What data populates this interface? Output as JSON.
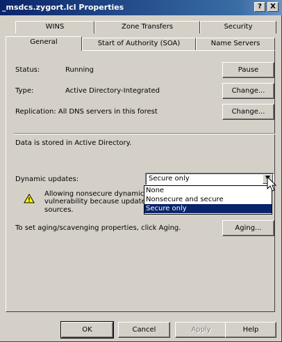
{
  "window": {
    "title": "_msdcs.zygort.lcl Properties",
    "help_label": "?",
    "close_label": "X"
  },
  "tabs_row1": [
    "WINS",
    "Zone Transfers",
    "Security"
  ],
  "tabs_row2": [
    "General",
    "Start of Authority (SOA)",
    "Name Servers"
  ],
  "active_tab": "General",
  "general": {
    "status_label": "Status:",
    "status_value": "Running",
    "pause_label": "Pause",
    "type_label": "Type:",
    "type_value": "Active Directory-Integrated",
    "change_type_label": "Change...",
    "replication_text": "Replication: All DNS servers in this forest",
    "change_replication_label": "Change...",
    "stored_text": "Data is stored in Active Directory.",
    "dynamic_updates_label": "Dynamic updates:",
    "dynamic_updates_value": "Secure only",
    "dynamic_options": [
      "None",
      "Nonsecure and secure",
      "Secure only"
    ],
    "warning_line1": "Allowing nonsecure dynamic u",
    "warning_line2": "vulnerability because updates",
    "warning_line3": "sources.",
    "aging_text": "To set aging/scavenging properties, click Aging.",
    "aging_button": "Aging..."
  },
  "footer": {
    "ok": "OK",
    "cancel": "Cancel",
    "apply": "Apply",
    "help": "Help"
  },
  "icons": {
    "warning": "warning-triangle-icon",
    "dropdown_arrow": "chevron-down-icon",
    "cursor": "mouse-pointer-icon"
  }
}
